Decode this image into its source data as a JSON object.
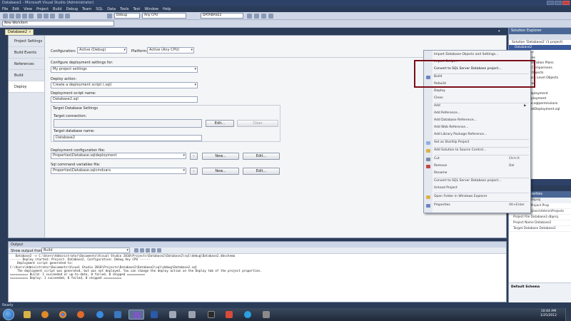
{
  "window": {
    "title": "Database1 - Microsoft Visual Studio (Administrator)"
  },
  "menu": [
    "File",
    "Edit",
    "View",
    "Project",
    "Build",
    "Debug",
    "Team",
    "SQL",
    "Data",
    "Tools",
    "Test",
    "Window",
    "Help"
  ],
  "toolbar": {
    "config": "Debug",
    "platform": "Any CPU",
    "target": "DATABASE2",
    "search_placeholder": "New Workitem"
  },
  "doc_tab": {
    "label": "Database2",
    "close": "×"
  },
  "prop_tabs": [
    "Project Settings",
    "Build Events",
    "References",
    "Build",
    "Deploy"
  ],
  "deploy": {
    "configuration_label": "Configuration:",
    "configuration_value": "Active (Debug)",
    "platform_label": "Platform:",
    "platform_value": "Active (Any CPU)",
    "configure_for_label": "Configure deployment settings for:",
    "configure_for_value": "My project settings",
    "action_label": "Deploy action:",
    "action_value": "Create a deployment script (.sql)",
    "script_name_label": "Deployment script name:",
    "script_name_value": "Database2.sql",
    "target_group_label": "Target Database Settings",
    "target_conn_label": "Target connection:",
    "edit_button": "Edit...",
    "clear_button": "Clear",
    "target_db_label": "Target database name:",
    "target_db_value": "Database2",
    "deploy_config_label": "Deployment configuration file:",
    "deploy_config_value": "Properties\\Database.sqldeployment",
    "sqlcmd_label": "Sql command variables file:",
    "sqlcmd_value": "Properties\\Database.sqlcmdvars",
    "new_button": "New...",
    "edit_button2": "Edit...",
    "dash": "–"
  },
  "output": {
    "title": "Output",
    "show_from_label": "Show output from:",
    "show_from_value": "Build",
    "lines": [
      "   Database2 -> C:\\Users\\Administrator\\Documents\\Visual Studio 2010\\Projects\\Database2\\Database2\\sql\\debug\\Database2.dbschema",
      "------ Deploy started: Project: Database2, Configuration: Debug Any CPU ------",
      "    Deployment script generated to:",
      "C:\\Users\\Administrator\\Documents\\Visual Studio 2010\\Projects\\Database2\\Database2\\sql\\debug\\Database2.sql",
      "",
      "    The deployment script was generated, but was not deployed. You can change the deploy action on the Deploy tab of the project properties.",
      "========== Build: 1 succeeded or up-to-date, 0 failed, 0 skipped ==========",
      "========== Deploy: 1 succeeded, 0 failed, 0 skipped =========="
    ]
  },
  "solution_explorer": {
    "title": "Solution Explorer",
    "items": [
      "Solution 'Database2' (1 project)",
      "Database2",
      "Properties",
      "References",
      "Data Generation Plans",
      "Schema Comparisons",
      "Schema Objects",
      "Database Level Objects",
      "Schemas",
      "Scripts",
      "Post-Deployment",
      "Pre-Deployment",
      "Database.sqlpermissions",
      "Script.PostDeployment.sql"
    ]
  },
  "properties": {
    "title": "Project Properties",
    "rows": [
      "Database2.dbproj",
      "Database2 Project Prop",
      "Full Path  C:\\Users\\Admin\\Projects",
      "Project File  Database2.dbproj",
      "Project Name  Database2",
      "Target Database  Database2"
    ],
    "desc_title": "Default Schema"
  },
  "context_menu": {
    "items": [
      {
        "label": "Import Database Objects and Settings...",
        "shortcut": ""
      },
      {
        "label": "Import Script...",
        "shortcut": ""
      },
      {
        "label": "Convert to SQL Server Database project...",
        "shortcut": ""
      },
      {
        "label": "Build",
        "shortcut": ""
      },
      {
        "label": "Rebuild",
        "shortcut": ""
      },
      {
        "label": "Deploy",
        "shortcut": ""
      },
      {
        "label": "Clean",
        "shortcut": ""
      },
      {
        "label": "Add",
        "shortcut": "▶"
      },
      {
        "label": "Add Reference...",
        "shortcut": ""
      },
      {
        "label": "Add Database Reference...",
        "shortcut": ""
      },
      {
        "label": "Add Web Reference...",
        "shortcut": ""
      },
      {
        "label": "Add Library Package Reference...",
        "shortcut": ""
      },
      {
        "label": "Set as StartUp Project",
        "shortcut": ""
      },
      {
        "label": "Add Solution to Source Control...",
        "shortcut": ""
      },
      {
        "label": "Cut",
        "shortcut": "Ctrl+X"
      },
      {
        "label": "Remove",
        "shortcut": "Del"
      },
      {
        "label": "Rename",
        "shortcut": ""
      },
      {
        "label": "Convert to SQL Server Database project...",
        "shortcut": ""
      },
      {
        "label": "Unload Project",
        "shortcut": ""
      },
      {
        "label": "Open Folder in Windows Explorer",
        "shortcut": ""
      },
      {
        "label": "Properties",
        "shortcut": "Alt+Enter"
      }
    ]
  },
  "status": {
    "text": "Ready"
  },
  "clock": {
    "time": "10:44 AM",
    "date": "1/25/2012"
  }
}
